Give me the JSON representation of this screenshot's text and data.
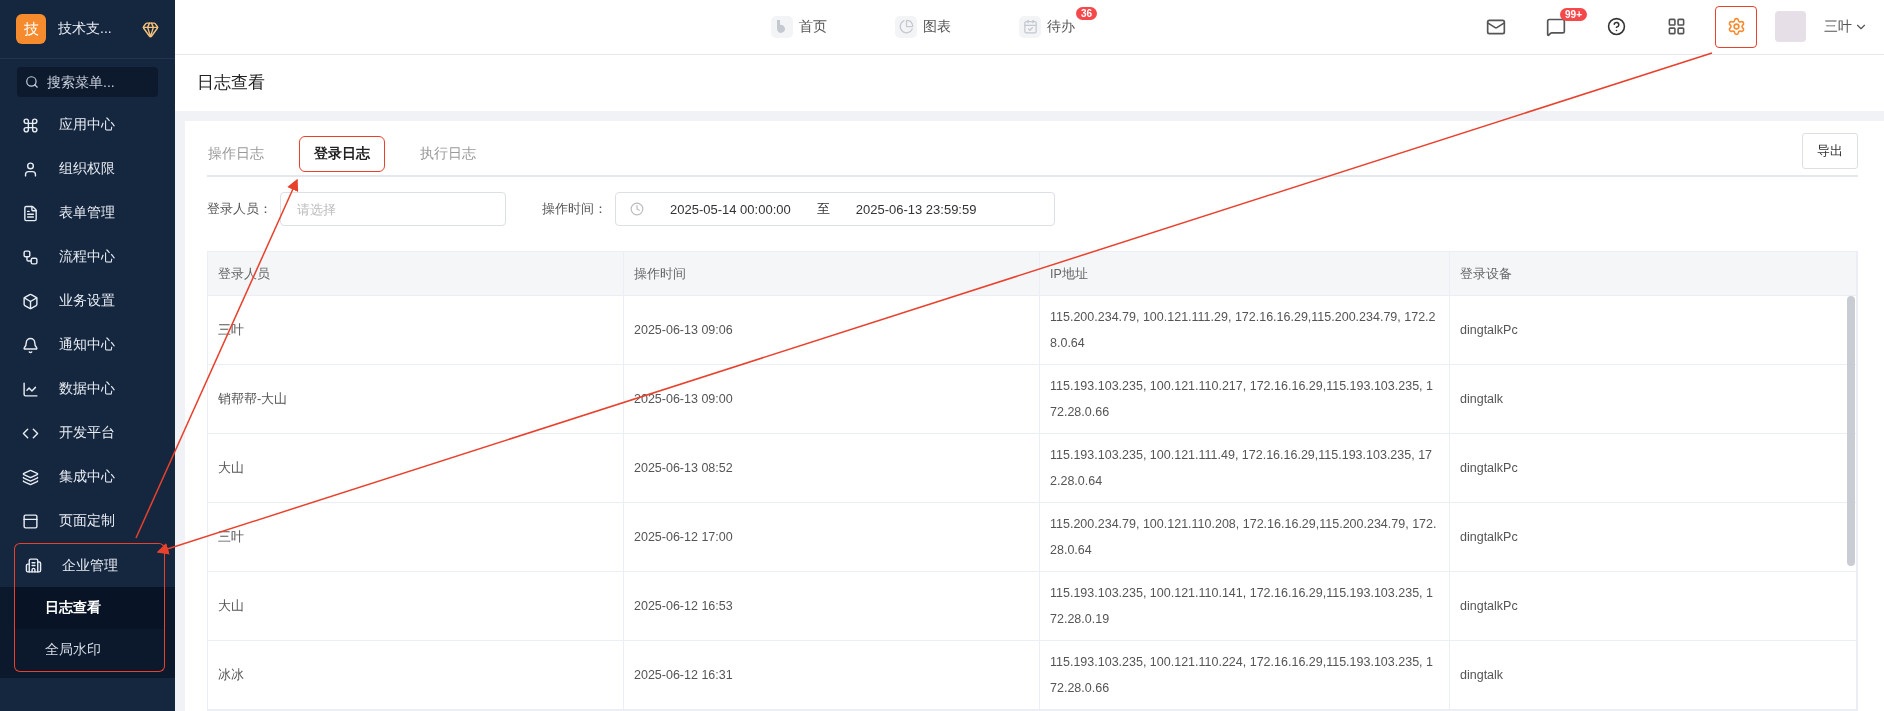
{
  "sidebar": {
    "logo": "技",
    "org": "技术支...",
    "search": {
      "placeholder": "搜索菜单..."
    },
    "items": [
      {
        "label": "应用中心",
        "highlighted": false
      },
      {
        "label": "组织权限",
        "highlighted": false
      },
      {
        "label": "表单管理",
        "highlighted": false
      },
      {
        "label": "流程中心",
        "highlighted": false
      },
      {
        "label": "业务设置",
        "highlighted": false
      },
      {
        "label": "通知中心",
        "highlighted": false
      },
      {
        "label": "数据中心",
        "highlighted": false
      },
      {
        "label": "开发平台",
        "highlighted": false
      },
      {
        "label": "集成中心",
        "highlighted": false
      },
      {
        "label": "页面定制",
        "highlighted": false
      },
      {
        "label": "企业管理",
        "expanded": true,
        "highlighted": true,
        "children": [
          {
            "label": "日志查看",
            "selected": true
          },
          {
            "label": "全局水印",
            "selected": false
          }
        ]
      }
    ]
  },
  "topbar": {
    "nav": [
      {
        "label": "首页"
      },
      {
        "label": "图表"
      },
      {
        "label": "待办",
        "badge": "36"
      }
    ],
    "chat_badge": "99+",
    "settings_highlighted": true,
    "user": "三叶"
  },
  "page_title": "日志查看",
  "tabs": [
    {
      "label": "操作日志",
      "selected": false,
      "highlighted": false
    },
    {
      "label": "登录日志",
      "selected": true,
      "highlighted": true
    },
    {
      "label": "执行日志",
      "selected": false,
      "highlighted": false
    }
  ],
  "export_button": "导出",
  "filters": {
    "person_label": "登录人员：",
    "person_placeholder": "请选择",
    "time_label": "操作时间：",
    "start": "2025-05-14 00:00:00",
    "separator": "至",
    "end": "2025-06-13 23:59:59"
  },
  "table": {
    "columns": [
      "登录人员",
      "操作时间",
      "IP地址",
      "登录设备"
    ],
    "rows": [
      [
        "三叶",
        "2025-06-13 09:06",
        "115.200.234.79, 100.121.111.29, 172.16.16.29,115.200.234.79, 172.28.0.64",
        "dingtalkPc"
      ],
      [
        "销帮帮-大山",
        "2025-06-13 09:00",
        "115.193.103.235, 100.121.110.217, 172.16.16.29,115.193.103.235, 172.28.0.66",
        "dingtalk"
      ],
      [
        "大山",
        "2025-06-13 08:52",
        "115.193.103.235, 100.121.111.49, 172.16.16.29,115.193.103.235, 172.28.0.64",
        "dingtalkPc"
      ],
      [
        "三叶",
        "2025-06-12 17:00",
        "115.200.234.79, 100.121.110.208, 172.16.16.29,115.200.234.79, 172.28.0.64",
        "dingtalkPc"
      ],
      [
        "大山",
        "2025-06-12 16:53",
        "115.193.103.235, 100.121.110.141, 172.16.16.29,115.193.103.235, 172.28.0.19",
        "dingtalkPc"
      ],
      [
        "冰冰",
        "2025-06-12 16:31",
        "115.193.103.235, 100.121.110.224, 172.16.16.29,115.193.103.235, 172.28.0.66",
        "dingtalk"
      ]
    ]
  }
}
